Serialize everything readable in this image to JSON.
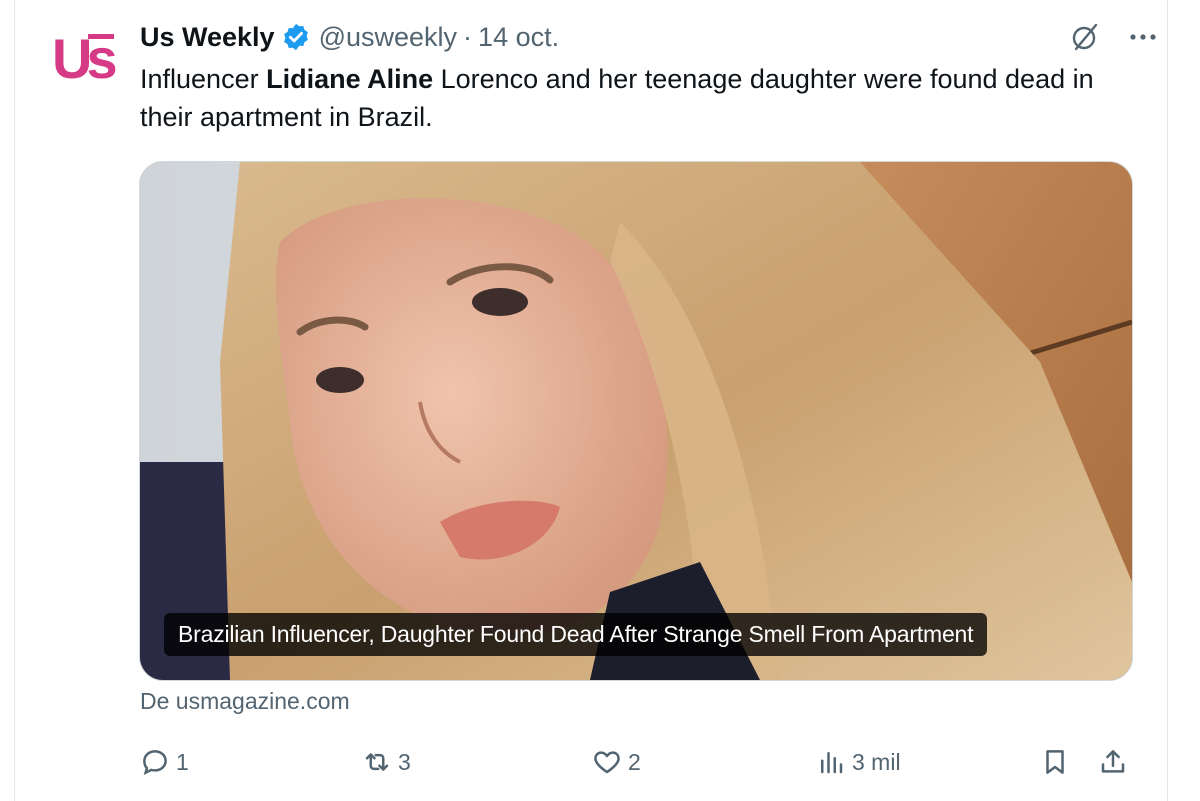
{
  "tweet": {
    "author_name": "Us Weekly",
    "handle": "@usweekly",
    "separator": "·",
    "date": "14 oct.",
    "text_part1": "Influencer ",
    "text_bold": "Lidiane Aline",
    "text_part2": " Lorenco and her teenage daughter were found dead in their apartment in Brazil.",
    "avatar_text": "Us",
    "media_caption": "Brazilian Influencer, Daughter Found Dead After Strange Smell From Apartment",
    "source": "De usmagazine.com"
  },
  "actions": {
    "replies": "1",
    "reposts": "3",
    "likes": "2",
    "views": "3 mil"
  },
  "icons": {
    "verified": "verified-badge-icon",
    "grok": "grok-icon",
    "more": "more-icon",
    "reply": "reply-icon",
    "repost": "repost-icon",
    "like": "heart-icon",
    "views": "views-icon",
    "bookmark": "bookmark-icon",
    "share": "share-icon"
  },
  "colors": {
    "avatar_pink": "#d63a86",
    "verified_blue": "#1d9bf0",
    "text": "#0f1419",
    "muted": "#536471",
    "border": "#cfd9de"
  }
}
